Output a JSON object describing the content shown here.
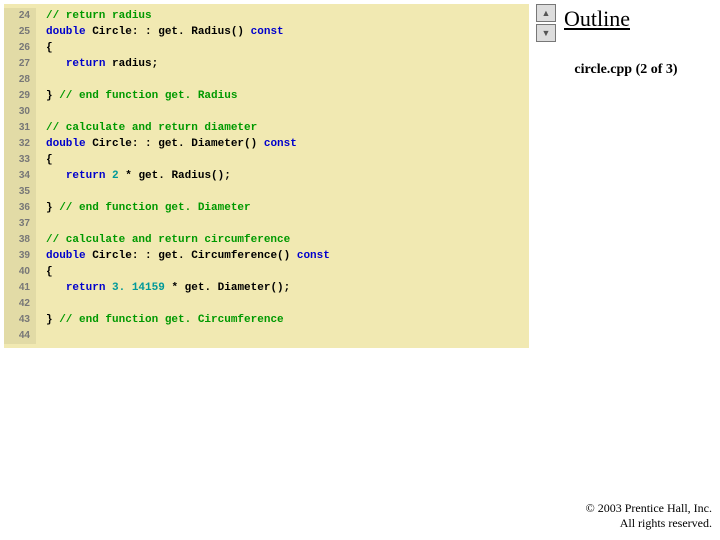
{
  "side": {
    "outline": "Outline",
    "file": "circle.cpp (2 of 3)"
  },
  "copyright": {
    "l1": "© 2003 Prentice Hall, Inc.",
    "l2": "All rights reserved."
  },
  "code": [
    {
      "n": "24",
      "seg": [
        [
          "com",
          "// return radius"
        ]
      ]
    },
    {
      "n": "25",
      "seg": [
        [
          "kw",
          "double"
        ],
        [
          "txt",
          " Circle: : get. Radius() "
        ],
        [
          "kw",
          "const"
        ]
      ]
    },
    {
      "n": "26",
      "seg": [
        [
          "txt",
          "{"
        ]
      ]
    },
    {
      "n": "27",
      "seg": [
        [
          "txt",
          "   "
        ],
        [
          "kw",
          "return"
        ],
        [
          "txt",
          " radius;"
        ]
      ]
    },
    {
      "n": "28",
      "seg": []
    },
    {
      "n": "29",
      "seg": [
        [
          "txt",
          "} "
        ],
        [
          "com",
          "// end function get. Radius"
        ]
      ]
    },
    {
      "n": "30",
      "seg": []
    },
    {
      "n": "31",
      "seg": [
        [
          "com",
          "// calculate and return diameter"
        ]
      ]
    },
    {
      "n": "32",
      "seg": [
        [
          "kw",
          "double"
        ],
        [
          "txt",
          " Circle: : get. Diameter() "
        ],
        [
          "kw",
          "const"
        ]
      ]
    },
    {
      "n": "33",
      "seg": [
        [
          "txt",
          "{"
        ]
      ]
    },
    {
      "n": "34",
      "seg": [
        [
          "txt",
          "   "
        ],
        [
          "kw",
          "return"
        ],
        [
          "txt",
          " "
        ],
        [
          "num",
          "2"
        ],
        [
          "txt",
          " * get. Radius();"
        ]
      ]
    },
    {
      "n": "35",
      "seg": []
    },
    {
      "n": "36",
      "seg": [
        [
          "txt",
          "} "
        ],
        [
          "com",
          "// end function get. Diameter"
        ]
      ]
    },
    {
      "n": "37",
      "seg": []
    },
    {
      "n": "38",
      "seg": [
        [
          "com",
          "// calculate and return circumference"
        ]
      ]
    },
    {
      "n": "39",
      "seg": [
        [
          "kw",
          "double"
        ],
        [
          "txt",
          " Circle: : get. Circumference() "
        ],
        [
          "kw",
          "const"
        ]
      ]
    },
    {
      "n": "40",
      "seg": [
        [
          "txt",
          "{"
        ]
      ]
    },
    {
      "n": "41",
      "seg": [
        [
          "txt",
          "   "
        ],
        [
          "kw",
          "return"
        ],
        [
          "txt",
          " "
        ],
        [
          "num",
          "3. 14159"
        ],
        [
          "txt",
          " * get. Diameter();"
        ]
      ]
    },
    {
      "n": "42",
      "seg": []
    },
    {
      "n": "43",
      "seg": [
        [
          "txt",
          "} "
        ],
        [
          "com",
          "// end function get. Circumference"
        ]
      ]
    },
    {
      "n": "44",
      "seg": []
    }
  ]
}
